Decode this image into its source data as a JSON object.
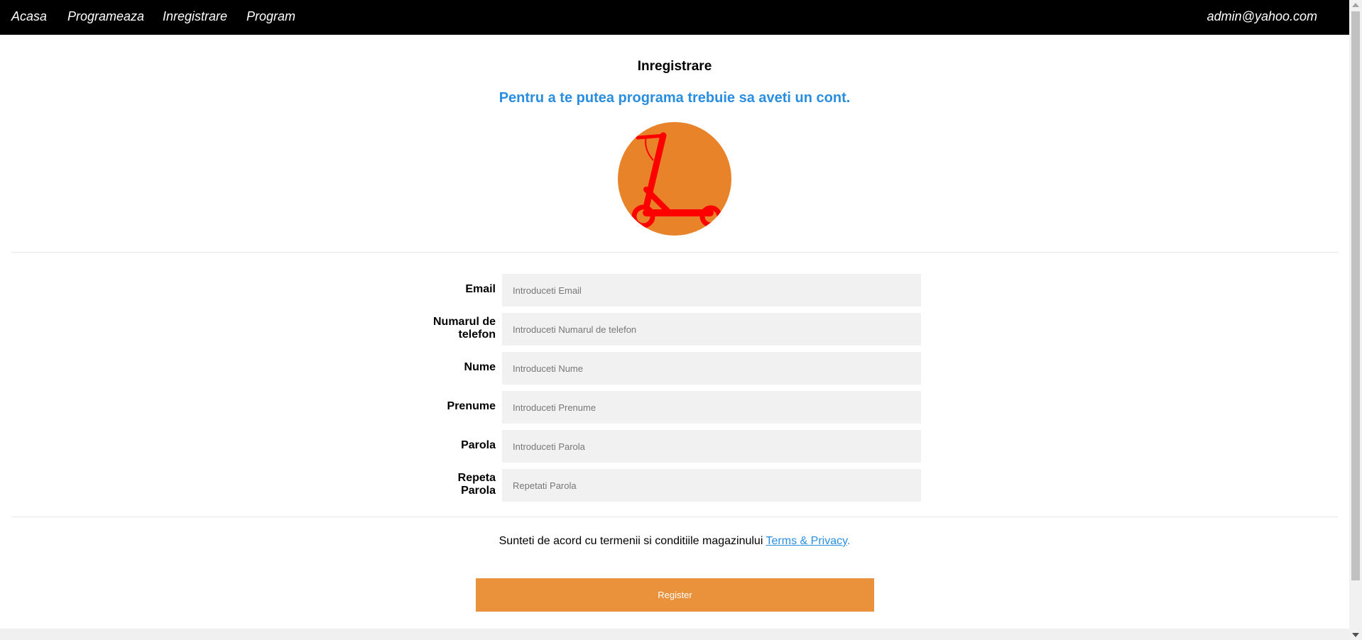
{
  "nav": {
    "links": [
      "Acasa",
      "Programeaza",
      "Inregistrare",
      "Program"
    ],
    "user": "admin@yahoo.com"
  },
  "page": {
    "title": "Inregistrare",
    "subtitle": "Pentru a te putea programa trebuie sa aveti un cont."
  },
  "logo": {
    "icon": "scooter-icon",
    "background_color": "#e8832a",
    "icon_color": "#ff0000"
  },
  "form": {
    "fields": [
      {
        "label_line1": "Email",
        "label_line2": "",
        "placeholder": "Introduceti Email"
      },
      {
        "label_line1": "Numarul de",
        "label_line2": "telefon",
        "placeholder": "Introduceti Numarul de telefon"
      },
      {
        "label_line1": "Nume",
        "label_line2": "",
        "placeholder": "Introduceti Nume"
      },
      {
        "label_line1": "Prenume",
        "label_line2": "",
        "placeholder": "Introduceti Prenume"
      },
      {
        "label_line1": "Parola",
        "label_line2": "",
        "placeholder": "Introduceti Parola"
      },
      {
        "label_line1": "Repeta",
        "label_line2": "Parola",
        "placeholder": "Repetati Parola"
      }
    ]
  },
  "terms": {
    "text": "Sunteti de acord cu termenii si conditiile magazinului ",
    "link": "Terms & Privacy",
    "suffix": "."
  },
  "register_button": "Register",
  "colors": {
    "accent_blue": "#2a8ee0",
    "button_orange": "#ea913b",
    "navbar": "#000000"
  }
}
